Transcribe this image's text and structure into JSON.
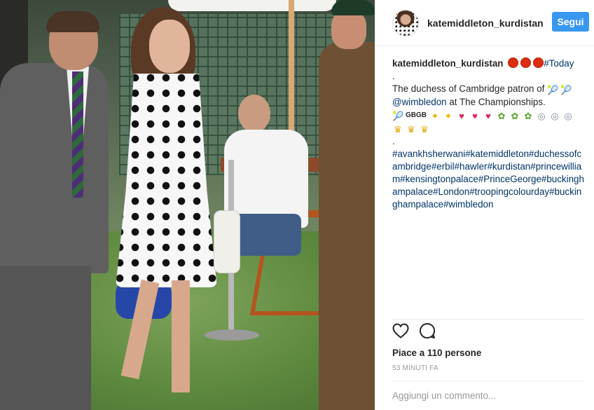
{
  "post": {
    "username": "katemiddleton_kurdistan",
    "follow_label": "Segui",
    "photo_icon": "post-photo"
  },
  "caption": {
    "username": "katemiddleton_kurdistan",
    "today_tag": "#Today",
    "dot_line": ".",
    "line1": "The duchess of Cambridge patron of",
    "mention": "@wimbledon",
    "line2": "at The Championships.",
    "flags": "GBGB",
    "dot_line2": ".",
    "hashtags": "#avankhsherwani#katemiddleton#duchessofcambridge#erbil#hawler#kurdistan#princewilliam#kensingtonpalace#PrinceGeorge#buckinghampalace#London#troopingcolourday#buckinghampalace#wimbledon",
    "emoji_row1": [
      "tennis-racquet",
      "tennis-racquet"
    ],
    "emoji_row2": [
      "tennis-racquet",
      "flag-gb",
      "sparkles",
      "sparkles",
      "heart",
      "heart",
      "heart",
      "bouquet",
      "bouquet",
      "bouquet",
      "ring",
      "ring",
      "ring"
    ],
    "emoji_row3": [
      "crown",
      "crown",
      "crown"
    ]
  },
  "actions": {
    "like_icon": "heart-outline-icon",
    "comment_icon": "comment-icon",
    "likes_text": "Piace a 110 persone",
    "time_text": "53 MINUTI FA"
  },
  "comment": {
    "placeholder": "Aggiungi un commento..."
  },
  "colors": {
    "follow_button": "#3897f0",
    "link": "#003569",
    "emoji_dot": "#dd2d10"
  }
}
